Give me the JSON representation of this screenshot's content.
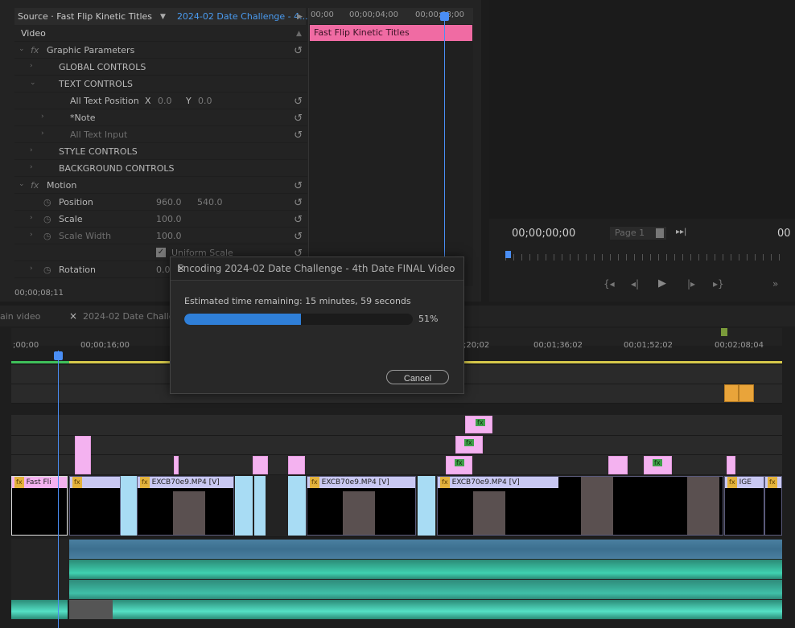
{
  "effect_controls": {
    "tab_source": "Source · Fast Flip Kinetic Titles",
    "tab_sequence": "2024-02 Date Challenge - 4...",
    "section_video": "Video",
    "graphic_parameters": "Graphic Parameters",
    "global_controls": "GLOBAL CONTROLS",
    "text_controls": "TEXT CONTROLS",
    "all_text_position": "All Text Position",
    "x_label": "X",
    "x_value": "0.0",
    "y_label": "Y",
    "y_value": "0.0",
    "note": "*Note",
    "all_text_input": "All Text Input",
    "style_controls": "STYLE CONTROLS",
    "background_controls": "BACKGROUND CONTROLS",
    "motion": "Motion",
    "position": "Position",
    "position_x": "960.0",
    "position_y": "540.0",
    "scale": "Scale",
    "scale_value": "100.0",
    "scale_width": "Scale Width",
    "scale_width_value": "100.0",
    "uniform_scale": "Uniform Scale",
    "rotation": "Rotation",
    "rotation_value": "0.0",
    "timecode": "00;00;08;11",
    "ruler_ticks": [
      "00;00",
      "00;00;04;00",
      "00;00;08;00"
    ],
    "clip_label": "Fast Flip Kinetic Titles"
  },
  "program_monitor": {
    "timecode": "00;00;00;00",
    "page": "Page 1",
    "right_timecode": "00"
  },
  "timeline": {
    "tab_main": "ain video",
    "tab_close": "×",
    "tab_sequence": "2024-02 Date Challen",
    "ruler_ticks": [
      ";00;00",
      "00;00;16;00",
      ";20;02",
      "00;01;36;02",
      "00;01;52;02",
      "00;02;08;04"
    ],
    "clip_fastflip": "Fast Fli",
    "clip_excb_1": "EXCB70e9.MP4 [V]",
    "clip_excb_2": "EXCB70e9.MP4 [V]",
    "clip_excb_3": "EXCB70e9.MP4 [V]",
    "clip_ige": "IGE",
    "fx": "fx"
  },
  "dialog": {
    "title": "Encoding 2024-02 Date Challenge - 4th Date FINAL Video",
    "estimate": "Estimated time remaining: 15 minutes, 59 seconds",
    "progress": 51,
    "progress_label": "51%",
    "cancel": "Cancel"
  },
  "colors": {
    "accent_blue": "#4a8ef5",
    "title_clip": "#f06ba3",
    "progress_fill": "#2f7fd8"
  }
}
